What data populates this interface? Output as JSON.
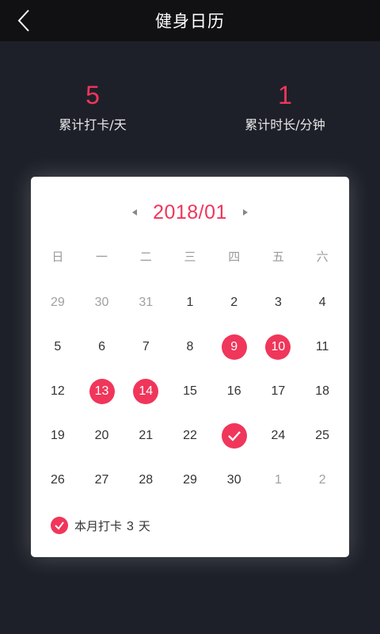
{
  "header": {
    "title": "健身日历",
    "back_icon": "chevron-left-icon"
  },
  "stats": {
    "checkin_total": {
      "value": "5",
      "label": "累计打卡/天"
    },
    "duration_total": {
      "value": "1",
      "label": "累计时长/分钟"
    }
  },
  "calendar": {
    "month": "2018/01",
    "prev_icon": "caret-left-icon",
    "next_icon": "caret-right-icon",
    "weekdays": [
      "日",
      "一",
      "二",
      "三",
      "四",
      "五",
      "六"
    ],
    "days": [
      {
        "label": "29",
        "state": "other"
      },
      {
        "label": "30",
        "state": "other"
      },
      {
        "label": "31",
        "state": "other"
      },
      {
        "label": "1",
        "state": "normal"
      },
      {
        "label": "2",
        "state": "normal"
      },
      {
        "label": "3",
        "state": "normal"
      },
      {
        "label": "4",
        "state": "normal"
      },
      {
        "label": "5",
        "state": "normal"
      },
      {
        "label": "6",
        "state": "normal"
      },
      {
        "label": "7",
        "state": "normal"
      },
      {
        "label": "8",
        "state": "normal"
      },
      {
        "label": "9",
        "state": "marked"
      },
      {
        "label": "10",
        "state": "marked"
      },
      {
        "label": "11",
        "state": "normal"
      },
      {
        "label": "12",
        "state": "normal"
      },
      {
        "label": "13",
        "state": "marked"
      },
      {
        "label": "14",
        "state": "marked"
      },
      {
        "label": "15",
        "state": "normal"
      },
      {
        "label": "16",
        "state": "normal"
      },
      {
        "label": "17",
        "state": "normal"
      },
      {
        "label": "18",
        "state": "normal"
      },
      {
        "label": "19",
        "state": "normal"
      },
      {
        "label": "20",
        "state": "normal"
      },
      {
        "label": "21",
        "state": "normal"
      },
      {
        "label": "22",
        "state": "normal"
      },
      {
        "label": "",
        "state": "checked"
      },
      {
        "label": "24",
        "state": "normal"
      },
      {
        "label": "25",
        "state": "normal"
      },
      {
        "label": "26",
        "state": "normal"
      },
      {
        "label": "27",
        "state": "normal"
      },
      {
        "label": "28",
        "state": "normal"
      },
      {
        "label": "29",
        "state": "normal"
      },
      {
        "label": "30",
        "state": "normal"
      },
      {
        "label": "1",
        "state": "other"
      },
      {
        "label": "2",
        "state": "other"
      }
    ]
  },
  "summary": {
    "prefix": "本月打卡",
    "count": "3",
    "suffix": "天",
    "icon": "check-circle-icon"
  },
  "colors": {
    "accent": "#f0365a",
    "background": "#1e2029",
    "topbar": "#111114",
    "card": "#ffffff"
  }
}
